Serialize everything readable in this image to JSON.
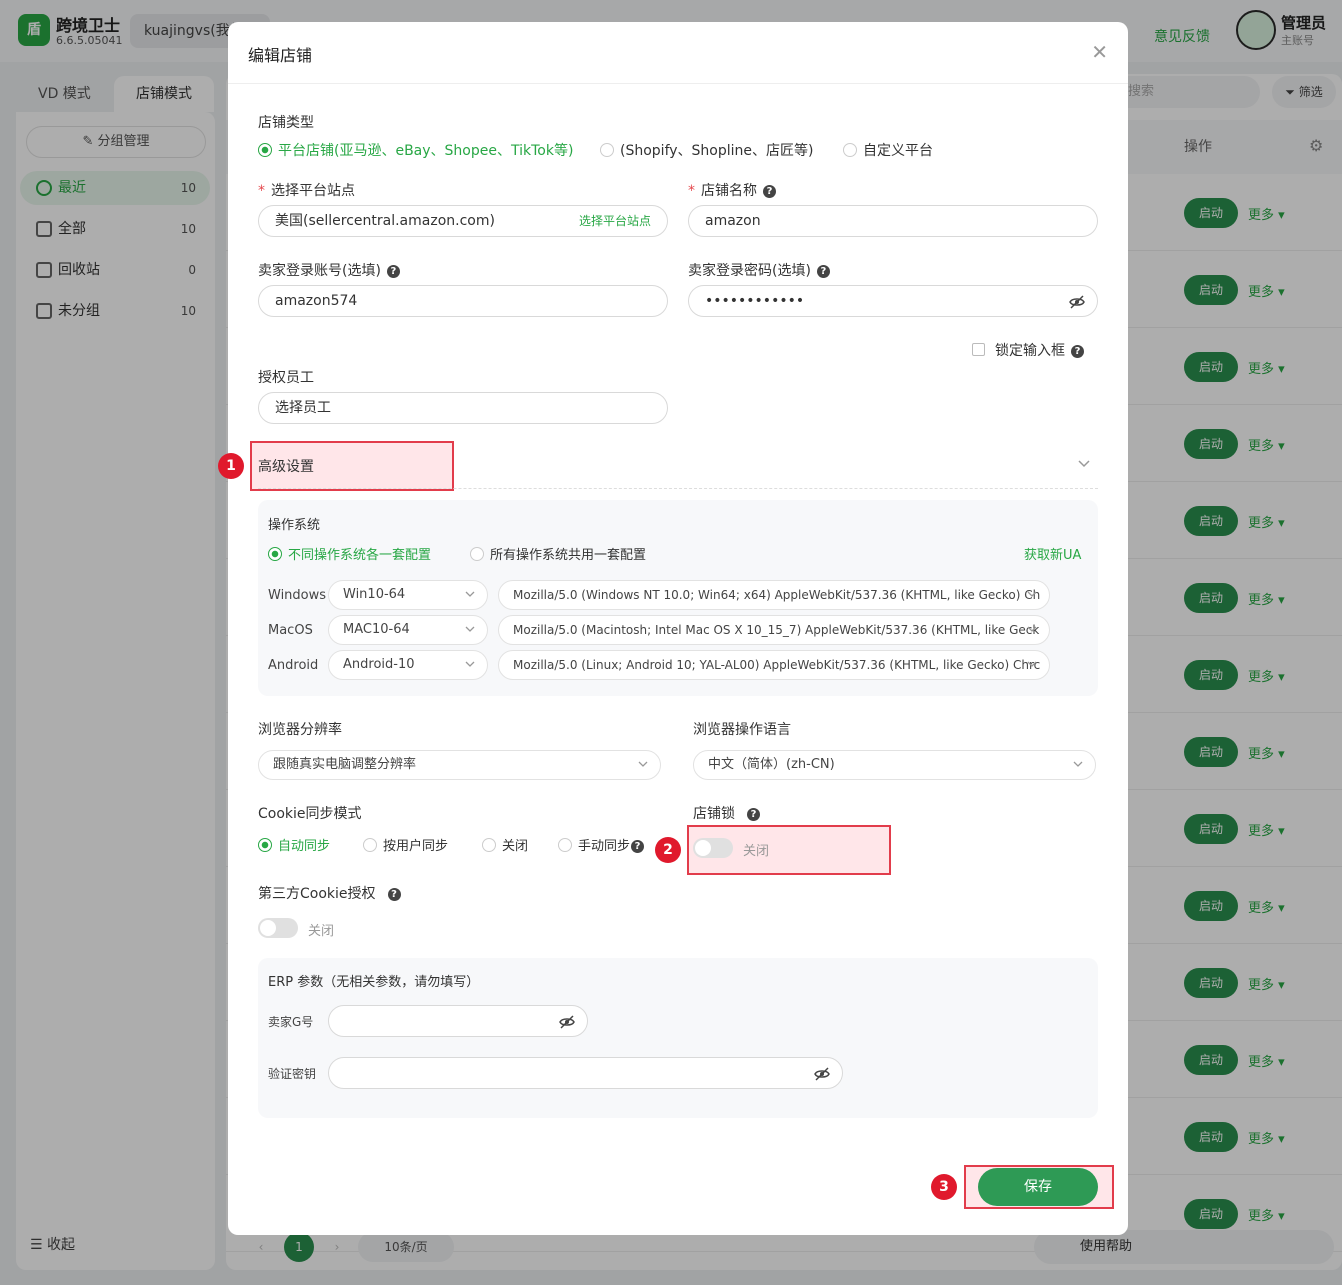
{
  "app": {
    "logo_char": "盾",
    "name": "跨境卫士",
    "version": "6.6.5.05041",
    "account_tab": "kuajingvs(我的",
    "feedback": "意见反馈",
    "user_name": "管理员",
    "user_role": "主账号"
  },
  "mode_tabs": [
    "VD 模式",
    "店铺模式"
  ],
  "sidebar": {
    "group_manage": "分组管理",
    "items": [
      {
        "label": "最近",
        "count": "10"
      },
      {
        "label": "全部",
        "count": "10"
      },
      {
        "label": "回收站",
        "count": "0"
      },
      {
        "label": "未分组",
        "count": "10"
      }
    ],
    "collapse": "收起"
  },
  "main": {
    "search_placeholder": "搜索",
    "filter": "筛选",
    "op_header": "操作",
    "start_label": "启动",
    "more_label": "更多",
    "page_current": "1",
    "page_size": "10条/页",
    "help": "使用帮助"
  },
  "modal": {
    "title": "编辑店铺",
    "shop_type_label": "店铺类型",
    "shop_types": [
      "平台店铺(亚马逊、eBay、Shopee、TikTok等)",
      "(Shopify、Shopline、店匠等)",
      "自定义平台"
    ],
    "site_label": "选择平台站点",
    "site_value": "美国(sellercentral.amazon.com)",
    "site_action": "选择平台站点",
    "shop_name_label": "店铺名称",
    "shop_name_value": "amazon",
    "account_label": "卖家登录账号(选填)",
    "account_value": "amazon574",
    "password_label": "卖家登录密码(选填)",
    "password_value": "••••••••••••",
    "lock_input": "锁定输入框",
    "staff_label": "授权员工",
    "staff_placeholder": "选择员工",
    "advanced": "高级设置",
    "os_label": "操作系统",
    "os_modes": [
      "不同操作系统各一套配置",
      "所有操作系统共用一套配置"
    ],
    "get_ua": "获取新UA",
    "os_rows": [
      {
        "os": "Windows",
        "version": "Win10-64",
        "ua": "Mozilla/5.0 (Windows NT 10.0; Win64; x64) AppleWebKit/537.36 (KHTML, like Gecko) Ch"
      },
      {
        "os": "MacOS",
        "version": "MAC10-64",
        "ua": "Mozilla/5.0 (Macintosh; Intel Mac OS X 10_15_7) AppleWebKit/537.36 (KHTML, like Geck"
      },
      {
        "os": "Android",
        "version": "Android-10",
        "ua": "Mozilla/5.0 (Linux; Android 10; YAL-AL00) AppleWebKit/537.36 (KHTML, like Gecko) Chrc"
      }
    ],
    "resolution_label": "浏览器分辨率",
    "resolution_value": "跟随真实电脑调整分辨率",
    "language_label": "浏览器操作语言",
    "language_value": "中文（简体）(zh-CN)",
    "cookie_label": "Cookie同步模式",
    "cookie_modes": [
      "自动同步",
      "按用户同步",
      "关闭",
      "手动同步"
    ],
    "shop_lock_label": "店铺锁",
    "shop_lock_state": "关闭",
    "third_cookie_label": "第三方Cookie授权",
    "third_cookie_state": "关闭",
    "erp_title": "ERP 参数（无相关参数，请勿填写）",
    "erp_seller_g": "卖家G号",
    "erp_verify_key": "验证密钥",
    "save": "保存"
  },
  "badges": [
    "1",
    "2",
    "3"
  ],
  "colors": {
    "brand_green": "#28a745",
    "button_green": "#2e9a55",
    "highlight_red": "#e23c4b",
    "badge_red": "#e0192c"
  }
}
